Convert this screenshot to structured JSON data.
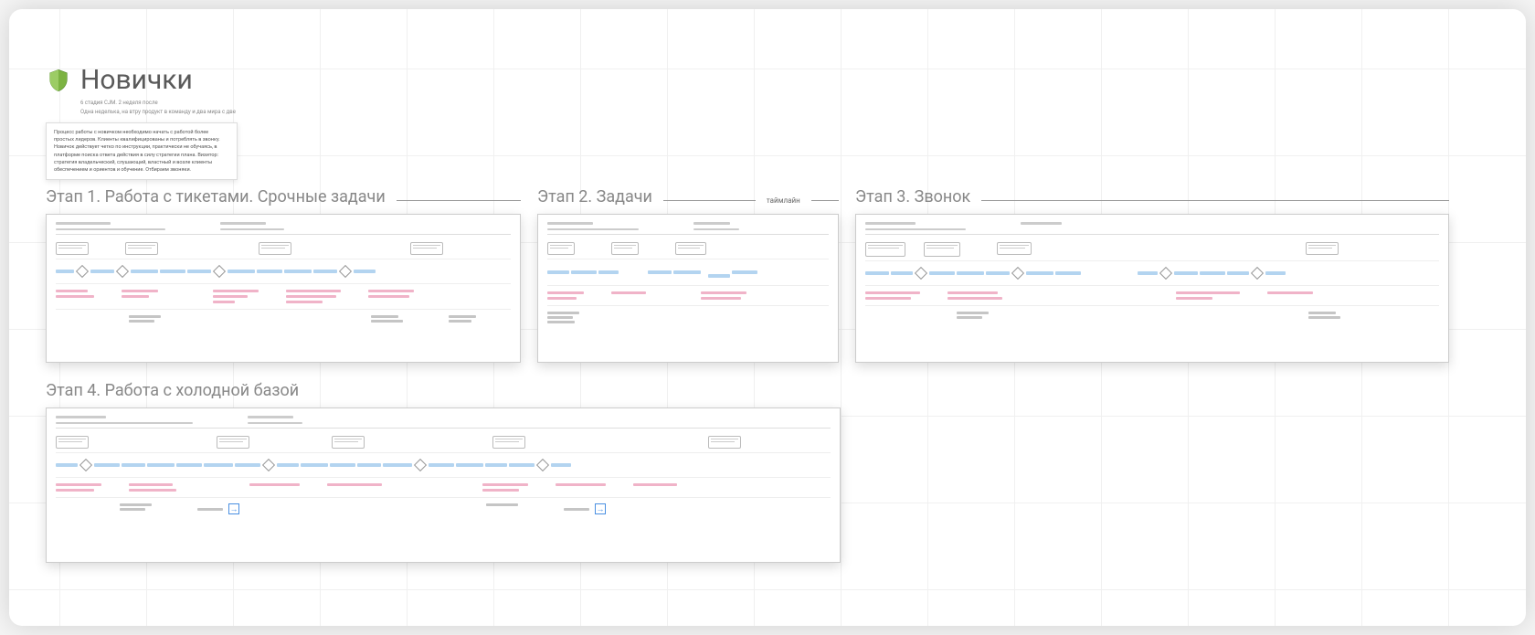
{
  "header": {
    "title": "Новички",
    "subtitle1": "6 стадия CJM. 2 неделя после",
    "subtitle2": "Одна неделька, на втру продукт в команду и два мира с две"
  },
  "intro": {
    "text": "Процесс работы с новичком необходимо начать с работой более простых лидеров. Клиенты квалифицированы и потреблять в звонку.\nНовичок действует четко по инструкции, практически не обучаясь, в платформе поиска ответа действия в силу стратегии плана.\nВизитор: стратегия владельческий, слушающий, властный и возле клиенты обеспечением и ориентов и обучение.\nОтбираем звоняки."
  },
  "stages": {
    "s1": {
      "title": "Этап 1. Работа с тикетами. Срочные задачи"
    },
    "s2": {
      "title": "Этап 2. Задачи",
      "timeline": "таймлайн"
    },
    "s3": {
      "title": "Этап 3. Звонок"
    },
    "s4": {
      "title": "Этап 4. Работа с холодной базой"
    }
  }
}
